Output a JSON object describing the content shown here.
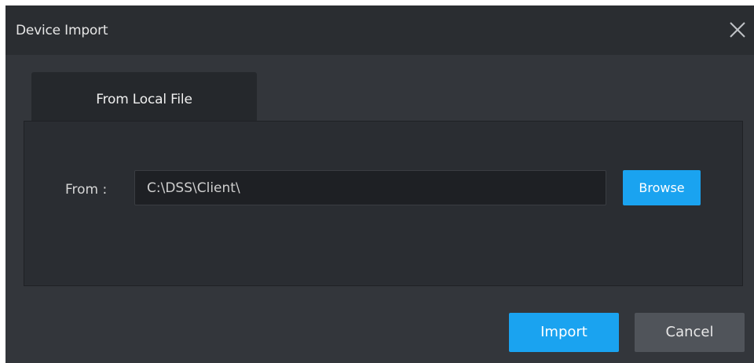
{
  "dialog": {
    "title": "Device Import",
    "close_icon": "close-icon"
  },
  "tabs": [
    {
      "label": "From Local File",
      "active": true
    }
  ],
  "import_panel": {
    "from_label": "From :",
    "path_value": "C:\\DSS\\Client\\",
    "browse_label": "Browse"
  },
  "footer": {
    "import_label": "Import",
    "cancel_label": "Cancel"
  },
  "colors": {
    "accent": "#1aa3f0",
    "dialog_bg": "#2b2e33",
    "secondary_button": "#50545a"
  }
}
